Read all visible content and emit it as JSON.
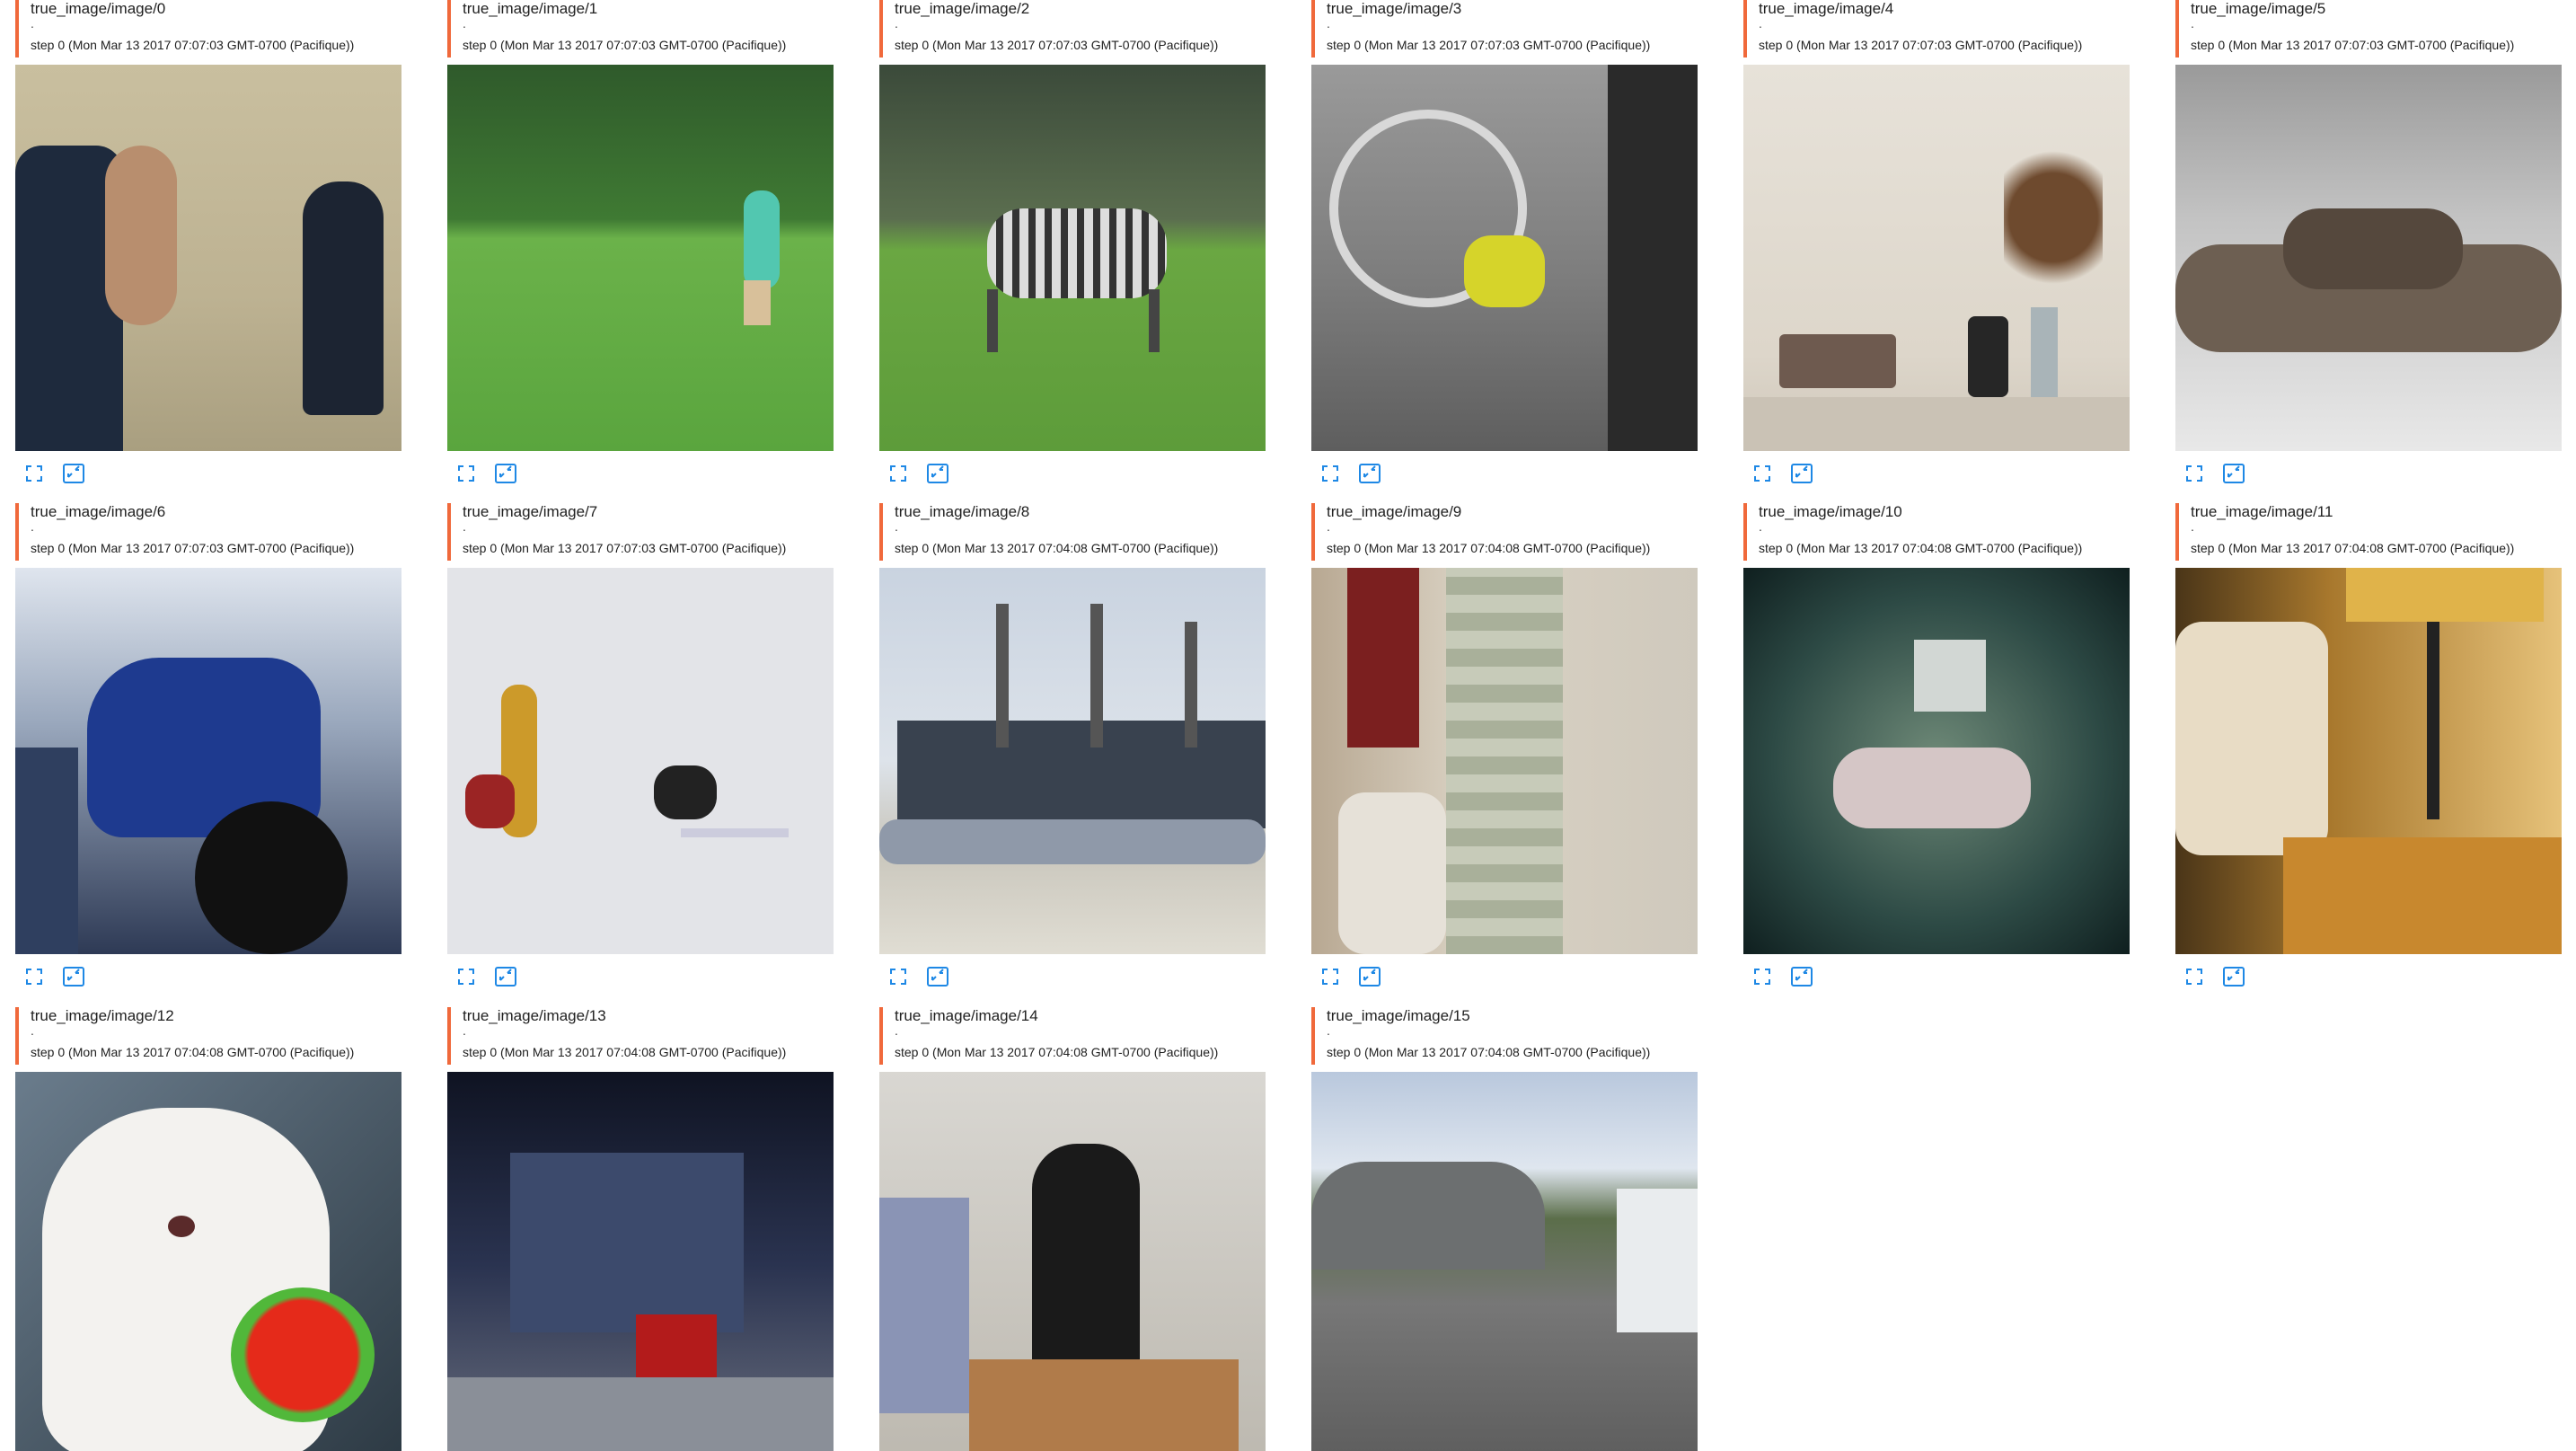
{
  "accent_color": "#f0693b",
  "icon_color": "#1e88e5",
  "cards": [
    {
      "title": "true_image/image/0",
      "dot": ".",
      "step": "step 0 (Mon Mar 13 2017 07:07:03 GMT-0700 (Pacifique))",
      "scene": "person-and-hydrant"
    },
    {
      "title": "true_image/image/1",
      "dot": ".",
      "step": "step 0 (Mon Mar 13 2017 07:07:03 GMT-0700 (Pacifique))",
      "scene": "park-frisbee"
    },
    {
      "title": "true_image/image/2",
      "dot": ".",
      "step": "step 0 (Mon Mar 13 2017 07:07:03 GMT-0700 (Pacifique))",
      "scene": "zebra-grazing"
    },
    {
      "title": "true_image/image/3",
      "dot": ".",
      "step": "step 0 (Mon Mar 13 2017 07:07:03 GMT-0700 (Pacifique))",
      "scene": "tennis-racket"
    },
    {
      "title": "true_image/image/4",
      "dot": ".",
      "step": "step 0 (Mon Mar 13 2017 07:07:03 GMT-0700 (Pacifique))",
      "scene": "shelf-vase"
    },
    {
      "title": "true_image/image/5",
      "dot": ".",
      "step": "step 0 (Mon Mar 13 2017 07:07:03 GMT-0700 (Pacifique))",
      "scene": "sheep-snow"
    },
    {
      "title": "true_image/image/6",
      "dot": ".",
      "step": "step 0 (Mon Mar 13 2017 07:07:03 GMT-0700 (Pacifique))",
      "scene": "motorcycle"
    },
    {
      "title": "true_image/image/7",
      "dot": ".",
      "step": "step 0 (Mon Mar 13 2017 07:07:03 GMT-0700 (Pacifique))",
      "scene": "snowboarders"
    },
    {
      "title": "true_image/image/8",
      "dot": ".",
      "step": "step 0 (Mon Mar 13 2017 07:04:08 GMT-0700 (Pacifique))",
      "scene": "airport"
    },
    {
      "title": "true_image/image/9",
      "dot": ".",
      "step": "step 0 (Mon Mar 13 2017 07:04:08 GMT-0700 (Pacifique))",
      "scene": "bathroom"
    },
    {
      "title": "true_image/image/10",
      "dot": ".",
      "step": "step 0 (Mon Mar 13 2017 07:04:08 GMT-0700 (Pacifique))",
      "scene": "sheep-field"
    },
    {
      "title": "true_image/image/11",
      "dot": ".",
      "step": "step 0 (Mon Mar 13 2017 07:04:08 GMT-0700 (Pacifique))",
      "scene": "hotel-lamp"
    },
    {
      "title": "true_image/image/12",
      "dot": ".",
      "step": "step 0 (Mon Mar 13 2017 07:04:08 GMT-0700 (Pacifique))",
      "scene": "teddy-bear"
    },
    {
      "title": "true_image/image/13",
      "dot": ".",
      "step": "step 0 (Mon Mar 13 2017 07:04:08 GMT-0700 (Pacifique))",
      "scene": "market-stall"
    },
    {
      "title": "true_image/image/14",
      "dot": ".",
      "step": "step 0 (Mon Mar 13 2017 07:04:08 GMT-0700 (Pacifique))",
      "scene": "coffee-machine"
    },
    {
      "title": "true_image/image/15",
      "dot": ".",
      "step": "step 0 (Mon Mar 13 2017 07:04:08 GMT-0700 (Pacifique))",
      "scene": "street"
    }
  ],
  "icons": {
    "expand": "fullscreen-icon",
    "fit": "fit-to-card-icon"
  }
}
